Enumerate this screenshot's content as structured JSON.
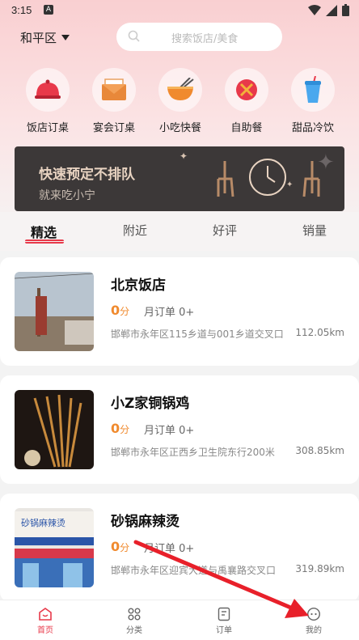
{
  "status": {
    "time": "3:15",
    "sim_label": "A"
  },
  "header": {
    "location": "和平区",
    "search_placeholder": "搜索饭店/美食"
  },
  "categories": [
    {
      "label": "饭店订桌",
      "icon": "cloche-icon"
    },
    {
      "label": "宴会订桌",
      "icon": "invitation-icon"
    },
    {
      "label": "小吃快餐",
      "icon": "bowl-icon"
    },
    {
      "label": "自助餐",
      "icon": "fork-spoon-icon"
    },
    {
      "label": "甜品冷饮",
      "icon": "drink-cup-icon"
    }
  ],
  "banner": {
    "title": "快速预定不排队",
    "subtitle": "就来吃小宁"
  },
  "tabs": [
    "精选",
    "附近",
    "好评",
    "销量"
  ],
  "restaurants": [
    {
      "name": "北京饭店",
      "score": "0",
      "score_unit": "分",
      "orders": "月订单 0+",
      "address": "邯郸市永年区115乡道与001乡道交叉口",
      "distance": "112.05km"
    },
    {
      "name": "小Z家铜锅鸡",
      "score": "0",
      "score_unit": "分",
      "orders": "月订单 0+",
      "address": "邯郸市永年区正西乡卫生院东行200米",
      "distance": "308.85km"
    },
    {
      "name": "砂锅麻辣烫",
      "score": "0",
      "score_unit": "分",
      "orders": "月订单 0+",
      "address": "邯郸市永年区迎宾大道与禹襄路交叉口",
      "distance": "319.89km"
    }
  ],
  "shop_sign_text": "砂锅麻辣烫",
  "bottom_nav": [
    "首页",
    "分类",
    "订单",
    "我的"
  ],
  "colors": {
    "accent": "#e8394a",
    "score": "#f08a2e",
    "banner_bg": "#3c3838"
  }
}
